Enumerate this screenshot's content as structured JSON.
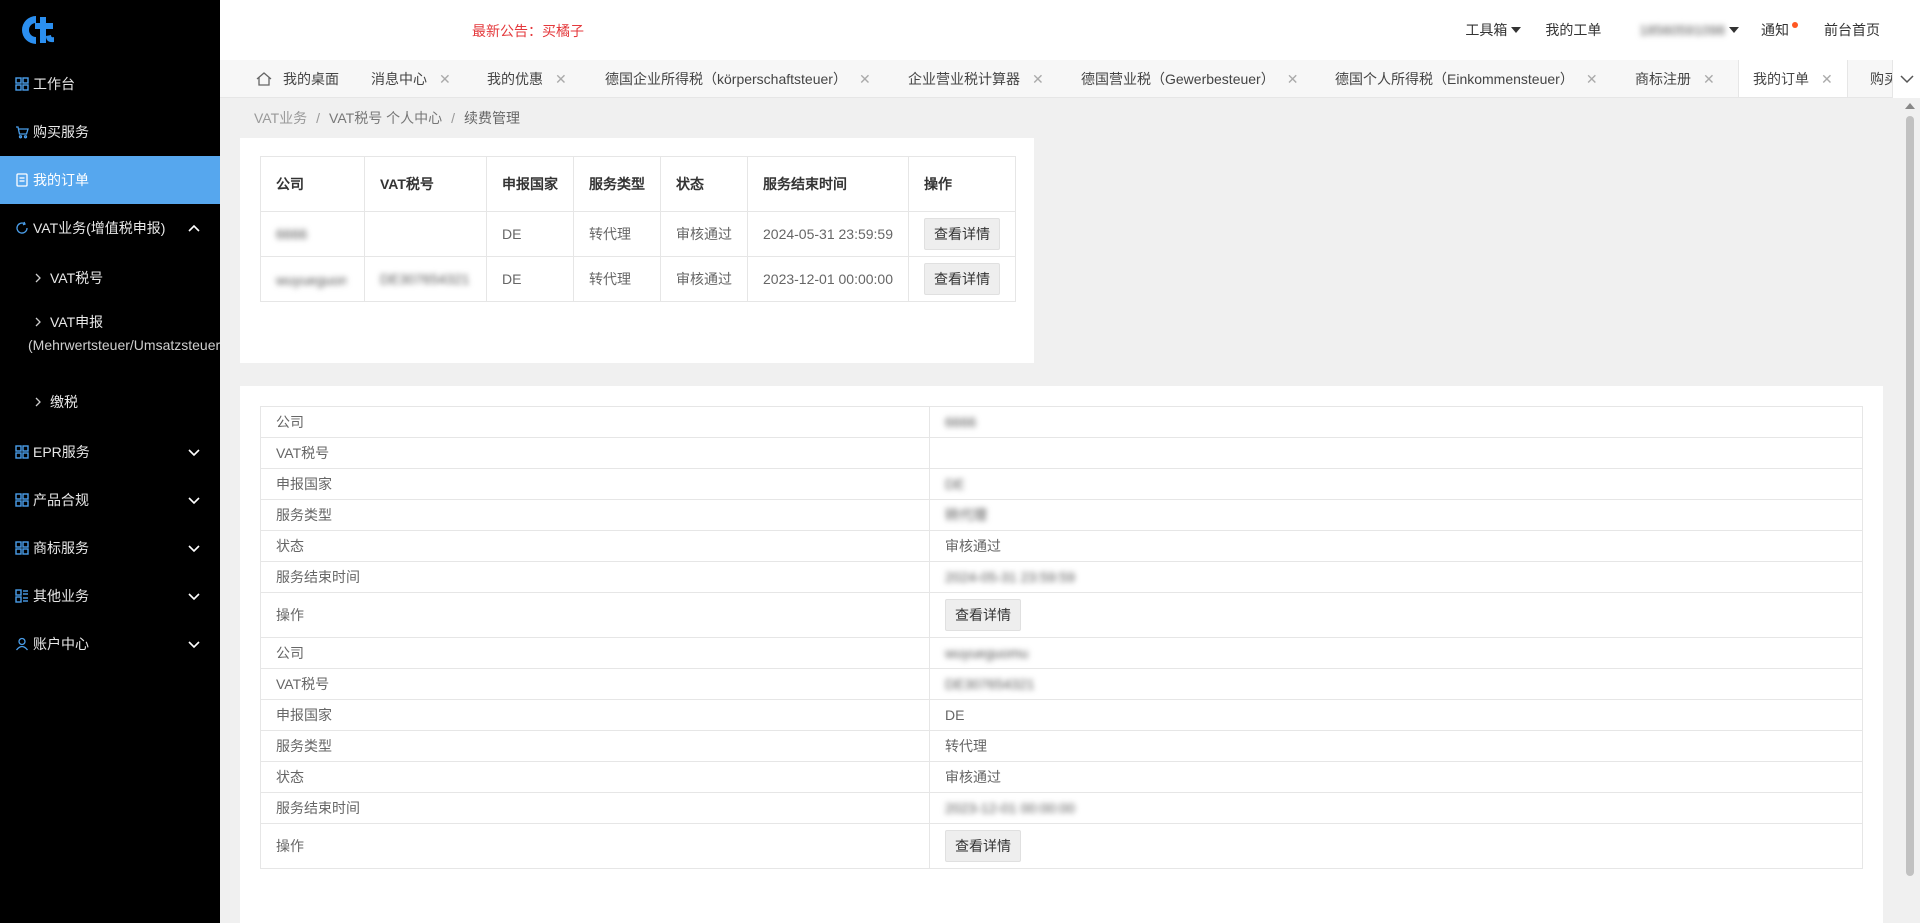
{
  "header": {
    "announcement": "最新公告：买橘子",
    "toolbox": "工具箱",
    "my_tickets": "我的工单",
    "user_phone": "18560591098",
    "notice": "通知",
    "frontend_home": "前台首页"
  },
  "sidebar": {
    "workbench": "工作台",
    "buy_service": "购买服务",
    "my_orders": "我的订单",
    "vat_business": "VAT业务(增值税申报)",
    "vat_number": "VAT税号",
    "vat_report": "VAT申报",
    "vat_report_sub": "(Mehrwertsteuer/Umsatzsteuer)",
    "pay_tax": "缴税",
    "epr_service": "EPR服务",
    "product_compliance": "产品合规",
    "trademark_service": "商标服务",
    "other_business": "其他业务",
    "account_center": "账户中心"
  },
  "tabs": [
    {
      "label": "我的桌面"
    },
    {
      "label": "消息中心"
    },
    {
      "label": "我的优惠"
    },
    {
      "label": "德国企业所得税（körperschaftsteuer）"
    },
    {
      "label": "企业营业税计算器"
    },
    {
      "label": "德国营业税（Gewerbesteuer）"
    },
    {
      "label": "德国个人所得税（Einkommensteuer）"
    },
    {
      "label": "商标注册"
    },
    {
      "label": "我的订单"
    },
    {
      "label": "购买"
    }
  ],
  "breadcrumb": {
    "root": "VAT业务",
    "middle": "VAT税号 个人中心",
    "current": "续费管理"
  },
  "table1": {
    "headers": [
      "公司",
      "VAT税号",
      "申报国家",
      "服务类型",
      "状态",
      "服务结束时间",
      "操作"
    ],
    "rows": [
      {
        "company": "6666",
        "vat": "",
        "country": "DE",
        "service": "转代理",
        "status": "审核通过",
        "end_time": "2024-05-31 23:59:59",
        "action": "查看详情"
      },
      {
        "company": "wuyueguomu",
        "vat": "DE307654321",
        "country": "DE",
        "service": "转代理",
        "status": "审核通过",
        "end_time": "2023-12-01 00:00:00",
        "action": "查看详情"
      }
    ]
  },
  "table2": {
    "labels": {
      "company": "公司",
      "vat": "VAT税号",
      "country": "申报国家",
      "service": "服务类型",
      "status": "状态",
      "end_time": "服务结束时间",
      "action": "操作"
    },
    "records": [
      {
        "company": "6666",
        "vat": "",
        "country": "DE",
        "service": "转代理",
        "status": "审核通过",
        "end_time": "2024-05-31 23:59:59",
        "action": "查看详情"
      },
      {
        "company": "wuyueguomu",
        "vat": "DE307654321",
        "country": "DE",
        "service": "转代理",
        "status": "审核通过",
        "end_time": "2023-12-01 00:00:00",
        "action": "查看详情"
      }
    ]
  },
  "colors": {
    "sidebar_bg": "#000000",
    "sidebar_active": "#56a7ee",
    "announcement": "#e4393c",
    "status_green": "#0f8a0f",
    "notice_dot": "#ff5722"
  }
}
